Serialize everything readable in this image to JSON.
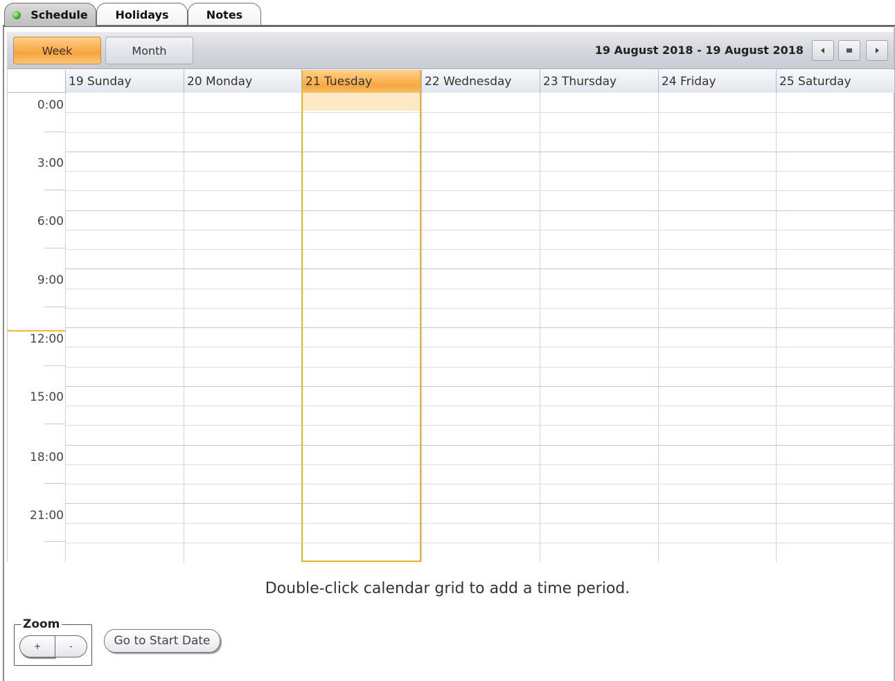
{
  "tabs": [
    {
      "label": "Schedule",
      "active": true
    },
    {
      "label": "Holidays",
      "active": false
    },
    {
      "label": "Notes",
      "active": false
    }
  ],
  "toolbar": {
    "week_label": "Week",
    "month_label": "Month",
    "date_range": "19 August 2018 - 19 August 2018",
    "nav": {
      "prev_icon": "triangle-left-icon",
      "today_icon": "square-icon",
      "next_icon": "triangle-right-icon"
    }
  },
  "days": [
    {
      "label": "19 Sunday",
      "today": false
    },
    {
      "label": "20 Monday",
      "today": false
    },
    {
      "label": "21 Tuesday",
      "today": true
    },
    {
      "label": "22 Wednesday",
      "today": false
    },
    {
      "label": "23 Thursday",
      "today": false
    },
    {
      "label": "24 Friday",
      "today": false
    },
    {
      "label": "25 Saturday",
      "today": false
    }
  ],
  "times": [
    "0:00",
    "3:00",
    "6:00",
    "9:00",
    "12:00",
    "15:00",
    "18:00",
    "21:00"
  ],
  "hint": "Double-click calendar grid to add a time period.",
  "zoom": {
    "title": "Zoom",
    "plus_label": "+",
    "minus_label": "-"
  },
  "start_button_label": "Go to Start Date",
  "colors": {
    "accent": "#f8a33d",
    "today_border": "#e9b22e",
    "today_slot": "#fde9c6",
    "status_dot": "#3fa82c"
  }
}
